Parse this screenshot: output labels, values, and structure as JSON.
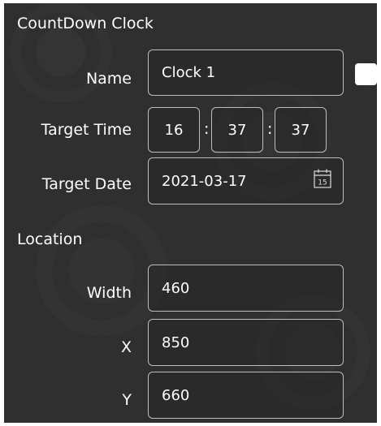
{
  "panel": {
    "title": "CountDown Clock"
  },
  "name": {
    "label": "Name",
    "value": "Clock 1"
  },
  "target_time": {
    "label": "Target Time",
    "hours": "16",
    "minutes": "37",
    "seconds": "37",
    "separator": ":"
  },
  "target_date": {
    "label": "Target Date",
    "value": "2021-03-17",
    "calendar_day": "15"
  },
  "location": {
    "heading": "Location",
    "width": {
      "label": "Width",
      "value": "460"
    },
    "x": {
      "label": "X",
      "value": "850"
    },
    "y": {
      "label": "Y",
      "value": "660"
    }
  },
  "icons": {
    "calendar": "calendar-icon"
  },
  "colors": {
    "panel_bg": "#2f2f2f",
    "field_border": "#bdbdbd",
    "text": "#ffffff"
  }
}
